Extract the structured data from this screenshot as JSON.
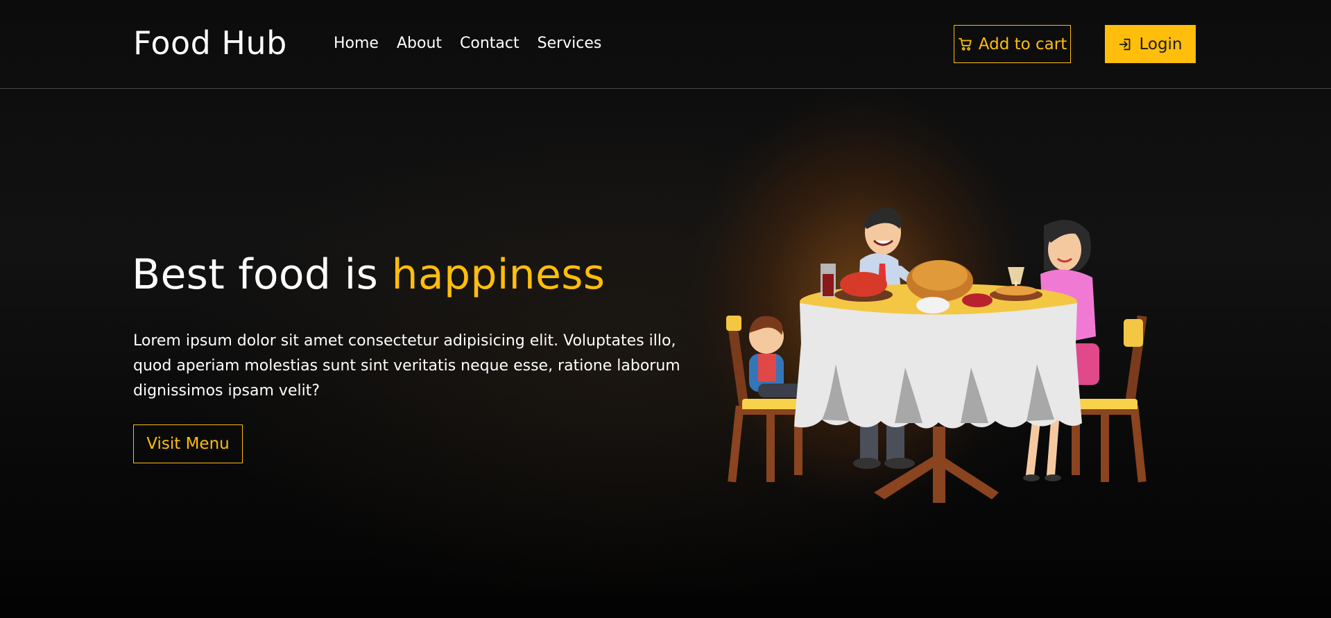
{
  "brand": {
    "name": "Food Hub"
  },
  "nav": {
    "items": [
      {
        "label": "Home"
      },
      {
        "label": "About"
      },
      {
        "label": "Contact"
      },
      {
        "label": "Services"
      }
    ]
  },
  "actions": {
    "cart_label": "Add to cart",
    "cart_icon": "cart-icon",
    "login_label": "Login",
    "login_icon": "login-icon"
  },
  "hero": {
    "title_plain": "Best food is ",
    "title_accent": "happiness",
    "description": "Lorem ipsum dolor sit amet consectetur adipisicing elit. Voluptates illo, quod aperiam molestias sunt sint veritatis neque esse, ratione laborum dignissimos ipsam velit?",
    "cta_label": "Visit Menu"
  },
  "colors": {
    "accent": "#ffbe0b",
    "background": "#000000",
    "text": "#ffffff"
  }
}
